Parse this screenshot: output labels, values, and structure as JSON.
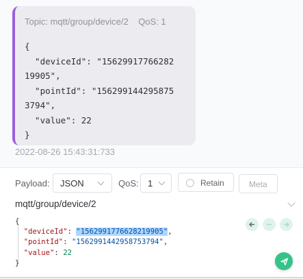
{
  "message": {
    "topic_line": "Topic: mqtt/group/device/2    QoS: 1",
    "payload_lines": [
      "{",
      "  \"deviceId\": \"15629917766282",
      "19905\",",
      "  \"pointId\": \"156299144295875",
      "3794\",",
      "  \"value\": 22",
      "}"
    ],
    "timestamp": "2022-08-26 15:43:31:733",
    "accent_color": "#9b5fe0"
  },
  "composer": {
    "payload_label": "Payload:",
    "payload_format": "JSON",
    "qos_label": "QoS:",
    "qos_value": "1",
    "retain_label": "Retain",
    "meta_label": "Meta",
    "topic": "mqtt/group/device/2",
    "code": {
      "open": "{",
      "device_key": "\"deviceId\"",
      "device_val": "\"1562991776628219905\"",
      "point_key": "\"pointId\"",
      "point_val": "\"1562991442958753794\"",
      "value_key": "\"value\"",
      "value_val": "22",
      "close": "}"
    },
    "send_color": "#34c388"
  }
}
